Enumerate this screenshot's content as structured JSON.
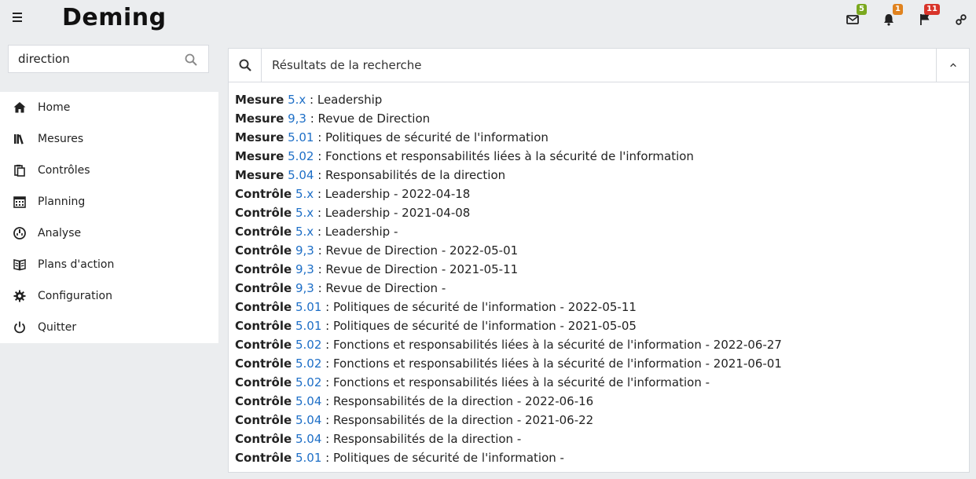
{
  "app": {
    "title": "Deming"
  },
  "header": {
    "mail": {
      "icon": "mail-icon",
      "count": "5",
      "color": "#7aa81e"
    },
    "bell": {
      "icon": "bell-icon",
      "count": "1",
      "color": "#e0821e"
    },
    "flag": {
      "icon": "flag-icon",
      "count": "11",
      "color": "#d8342a"
    },
    "user": {
      "icon": "user-settings-icon"
    }
  },
  "search": {
    "value": "direction",
    "icon": "search-icon"
  },
  "sidebar": {
    "items": [
      {
        "label": "Home",
        "icon": "home-icon"
      },
      {
        "label": "Mesures",
        "icon": "books-icon"
      },
      {
        "label": "Contrôles",
        "icon": "clipboard-icon"
      },
      {
        "label": "Planning",
        "icon": "calendar-icon"
      },
      {
        "label": "Analyse",
        "icon": "dashboard-icon"
      },
      {
        "label": "Plans d'action",
        "icon": "notes-icon"
      },
      {
        "label": "Configuration",
        "icon": "gear-icon"
      },
      {
        "label": "Quitter",
        "icon": "power-icon"
      }
    ]
  },
  "results_panel": {
    "title": "Résultats de la recherche",
    "items": [
      {
        "type": "Mesure",
        "code": "5.x",
        "text": " : Leadership"
      },
      {
        "type": "Mesure",
        "code": "9,3",
        "text": " : Revue de Direction"
      },
      {
        "type": "Mesure",
        "code": "5.01",
        "text": " : Politiques de sécurité de l'information"
      },
      {
        "type": "Mesure",
        "code": "5.02",
        "text": " : Fonctions et responsabilités liées à la sécurité de l'information"
      },
      {
        "type": "Mesure",
        "code": "5.04",
        "text": " : Responsabilités de la direction"
      },
      {
        "type": "Contrôle",
        "code": "5.x",
        "text": " : Leadership - 2022-04-18"
      },
      {
        "type": "Contrôle",
        "code": "5.x",
        "text": " : Leadership - 2021-04-08"
      },
      {
        "type": "Contrôle",
        "code": "5.x",
        "text": " : Leadership -"
      },
      {
        "type": "Contrôle",
        "code": "9,3",
        "text": " : Revue de Direction - 2022-05-01"
      },
      {
        "type": "Contrôle",
        "code": "9,3",
        "text": " : Revue de Direction - 2021-05-11"
      },
      {
        "type": "Contrôle",
        "code": "9,3",
        "text": " : Revue de Direction -"
      },
      {
        "type": "Contrôle",
        "code": "5.01",
        "text": " : Politiques de sécurité de l'information - 2022-05-11"
      },
      {
        "type": "Contrôle",
        "code": "5.01",
        "text": " : Politiques de sécurité de l'information - 2021-05-05"
      },
      {
        "type": "Contrôle",
        "code": "5.02",
        "text": " : Fonctions et responsabilités liées à la sécurité de l'information - 2022-06-27"
      },
      {
        "type": "Contrôle",
        "code": "5.02",
        "text": " : Fonctions et responsabilités liées à la sécurité de l'information - 2021-06-01"
      },
      {
        "type": "Contrôle",
        "code": "5.02",
        "text": " : Fonctions et responsabilités liées à la sécurité de l'information -"
      },
      {
        "type": "Contrôle",
        "code": "5.04",
        "text": " : Responsabilités de la direction - 2022-06-16"
      },
      {
        "type": "Contrôle",
        "code": "5.04",
        "text": " : Responsabilités de la direction - 2021-06-22"
      },
      {
        "type": "Contrôle",
        "code": "5.04",
        "text": " : Responsabilités de la direction -"
      },
      {
        "type": "Contrôle",
        "code": "5.01",
        "text": " : Politiques de sécurité de l'information -"
      }
    ]
  }
}
